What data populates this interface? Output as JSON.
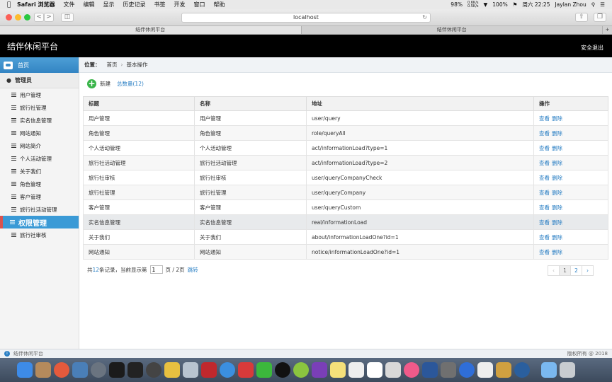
{
  "menubar": {
    "apple_icon": "apple-icon",
    "items": [
      "Safari 浏览器",
      "文件",
      "编辑",
      "显示",
      "历史记录",
      "书签",
      "开发",
      "窗口",
      "帮助"
    ],
    "battery": "98%",
    "net_up": "0.6K/s",
    "net_down": "0.5K/s",
    "battery2": "100%",
    "clock": "周六 22:25",
    "user": "Jaylan Zhou"
  },
  "browser": {
    "url": "localhost",
    "tabs": [
      "结伴休闲平台",
      "结伴休闲平台"
    ],
    "new_tab": "+",
    "back": "<",
    "forward": ">"
  },
  "header": {
    "title": "结伴休闲平台",
    "logout": "安全退出"
  },
  "sidebar": {
    "home": "首页",
    "admin_heading": "管理员",
    "items": [
      {
        "label": "用户管理"
      },
      {
        "label": "旅行社管理"
      },
      {
        "label": "实名信息管理"
      },
      {
        "label": "网站通知"
      },
      {
        "label": "网站简介"
      },
      {
        "label": "个人活动管理"
      },
      {
        "label": "关于我们"
      },
      {
        "label": "角色管理"
      },
      {
        "label": "客户管理"
      },
      {
        "label": "旅行社活动管理"
      },
      {
        "label": "权限管理"
      },
      {
        "label": "旅行社审核"
      }
    ],
    "active_index": 10
  },
  "breadcrumb": {
    "label": "位置：",
    "home": "首页",
    "current": "基本操作"
  },
  "toolbar": {
    "new_label": "新建",
    "total": "总数量(12)"
  },
  "table": {
    "headers": [
      "标题",
      "名称",
      "地址",
      "操作"
    ],
    "rows": [
      {
        "title": "用户管理",
        "name": "用户管理",
        "url": "user/query"
      },
      {
        "title": "角色管理",
        "name": "角色管理",
        "url": "role/queryAll"
      },
      {
        "title": "个人活动管理",
        "name": "个人活动管理",
        "url": "act/informationLoad?type=1"
      },
      {
        "title": "旅行社活动管理",
        "name": "旅行社活动管理",
        "url": "act/informationLoad?type=2"
      },
      {
        "title": "旅行社审核",
        "name": "旅行社审核",
        "url": "user/queryCompanyCheck"
      },
      {
        "title": "旅行社管理",
        "name": "旅行社管理",
        "url": "user/queryCompany"
      },
      {
        "title": "客户管理",
        "name": "客户管理",
        "url": "user/queryCustom"
      },
      {
        "title": "实名信息管理",
        "name": "实名信息管理",
        "url": "real/informationLoad"
      },
      {
        "title": "关于我们",
        "name": "关于我们",
        "url": "about/informationLoadOne?id=1"
      },
      {
        "title": "网站通知",
        "name": "网站通知",
        "url": "notice/informationLoadOne?id=1"
      }
    ],
    "view_label": "查看",
    "delete_label": "删除"
  },
  "pagination": {
    "prefix": "共",
    "count": "12",
    "records_suffix": "条记录，当前显示第",
    "current_page": "1",
    "page_sep": "页 / 2页",
    "jump": "跳转",
    "prev": "‹",
    "pages": [
      "1",
      "2"
    ],
    "next": "›"
  },
  "footer": {
    "text": "结伴休闲平台",
    "copyright": "版权所有 @ 2018"
  },
  "colors": {
    "accent": "#3a9ad6",
    "link": "#2a7fc4",
    "active_marker": "#d9534f",
    "header_bg": "#000000"
  }
}
